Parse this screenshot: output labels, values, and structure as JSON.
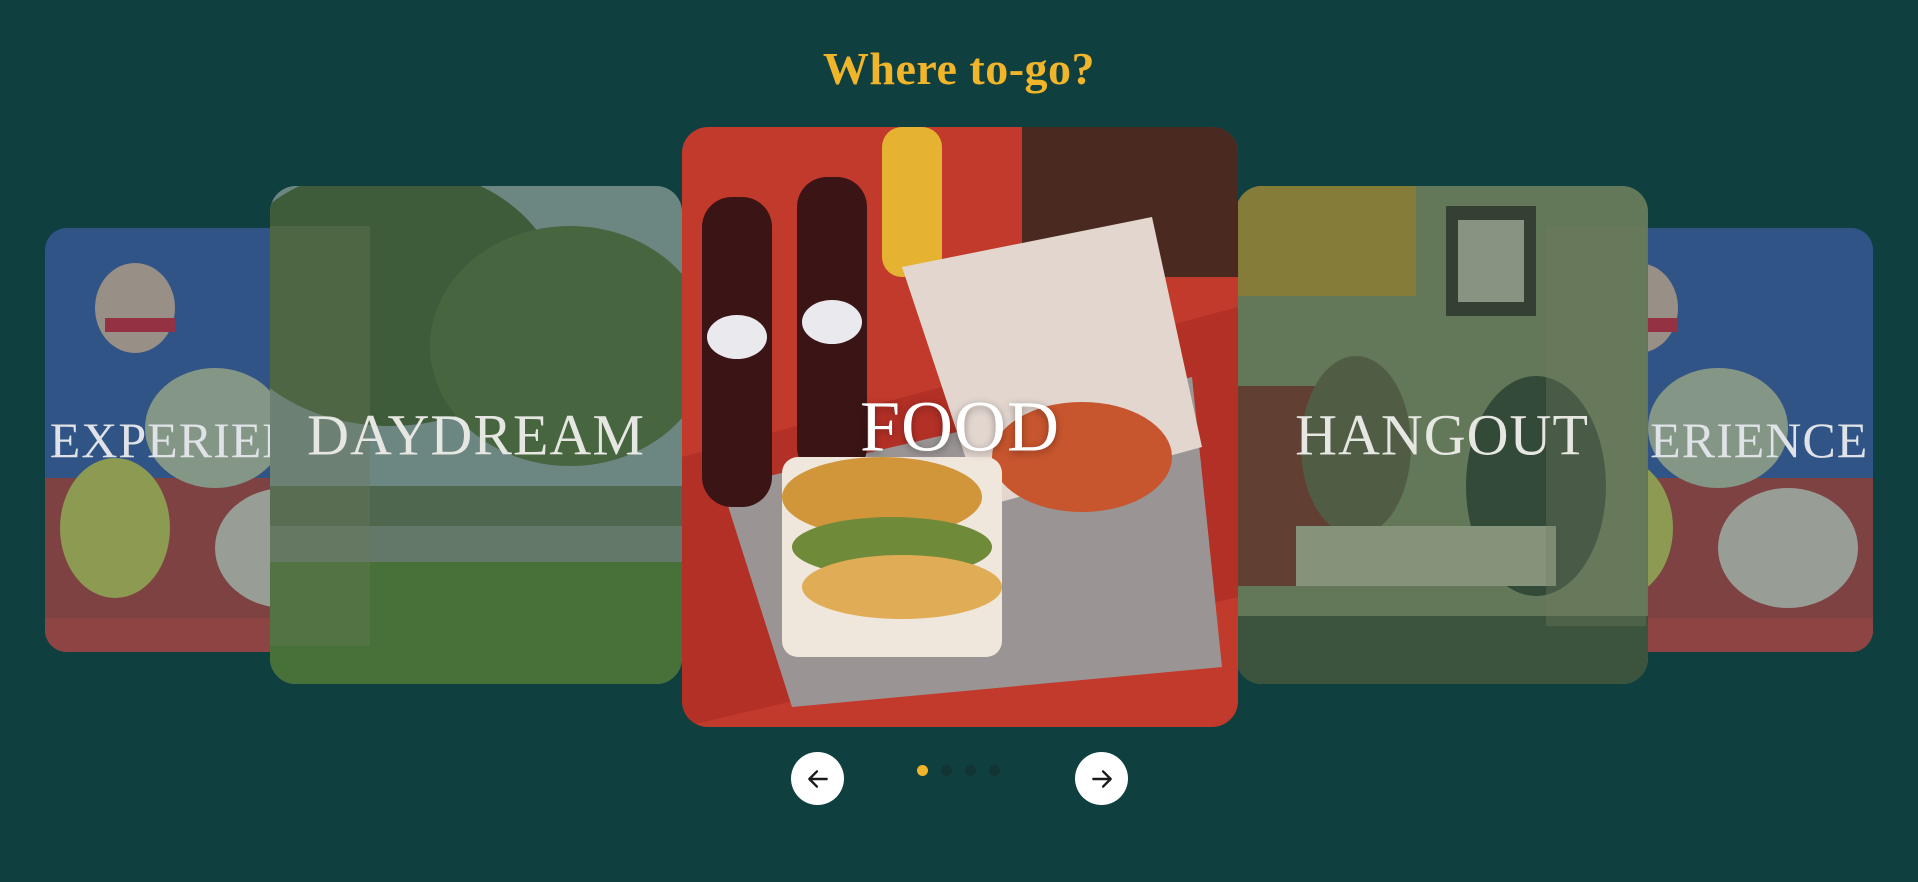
{
  "header": {
    "title": "Where to-go?"
  },
  "carousel": {
    "cards": [
      {
        "label": "EXPERIENCE",
        "position": "far-left"
      },
      {
        "label": "DAYDREAM",
        "position": "left"
      },
      {
        "label": "FOOD",
        "position": "center"
      },
      {
        "label": "HANGOUT",
        "position": "right"
      },
      {
        "label": "EXPERIENCE",
        "position": "far-right"
      }
    ],
    "dots": {
      "count": 4,
      "active_index": 0
    }
  },
  "colors": {
    "background": "#0f3f3f",
    "accent": "#f1b52a",
    "button": "#ffffff"
  },
  "icons": {
    "prev": "arrow-left-icon",
    "next": "arrow-right-icon"
  }
}
